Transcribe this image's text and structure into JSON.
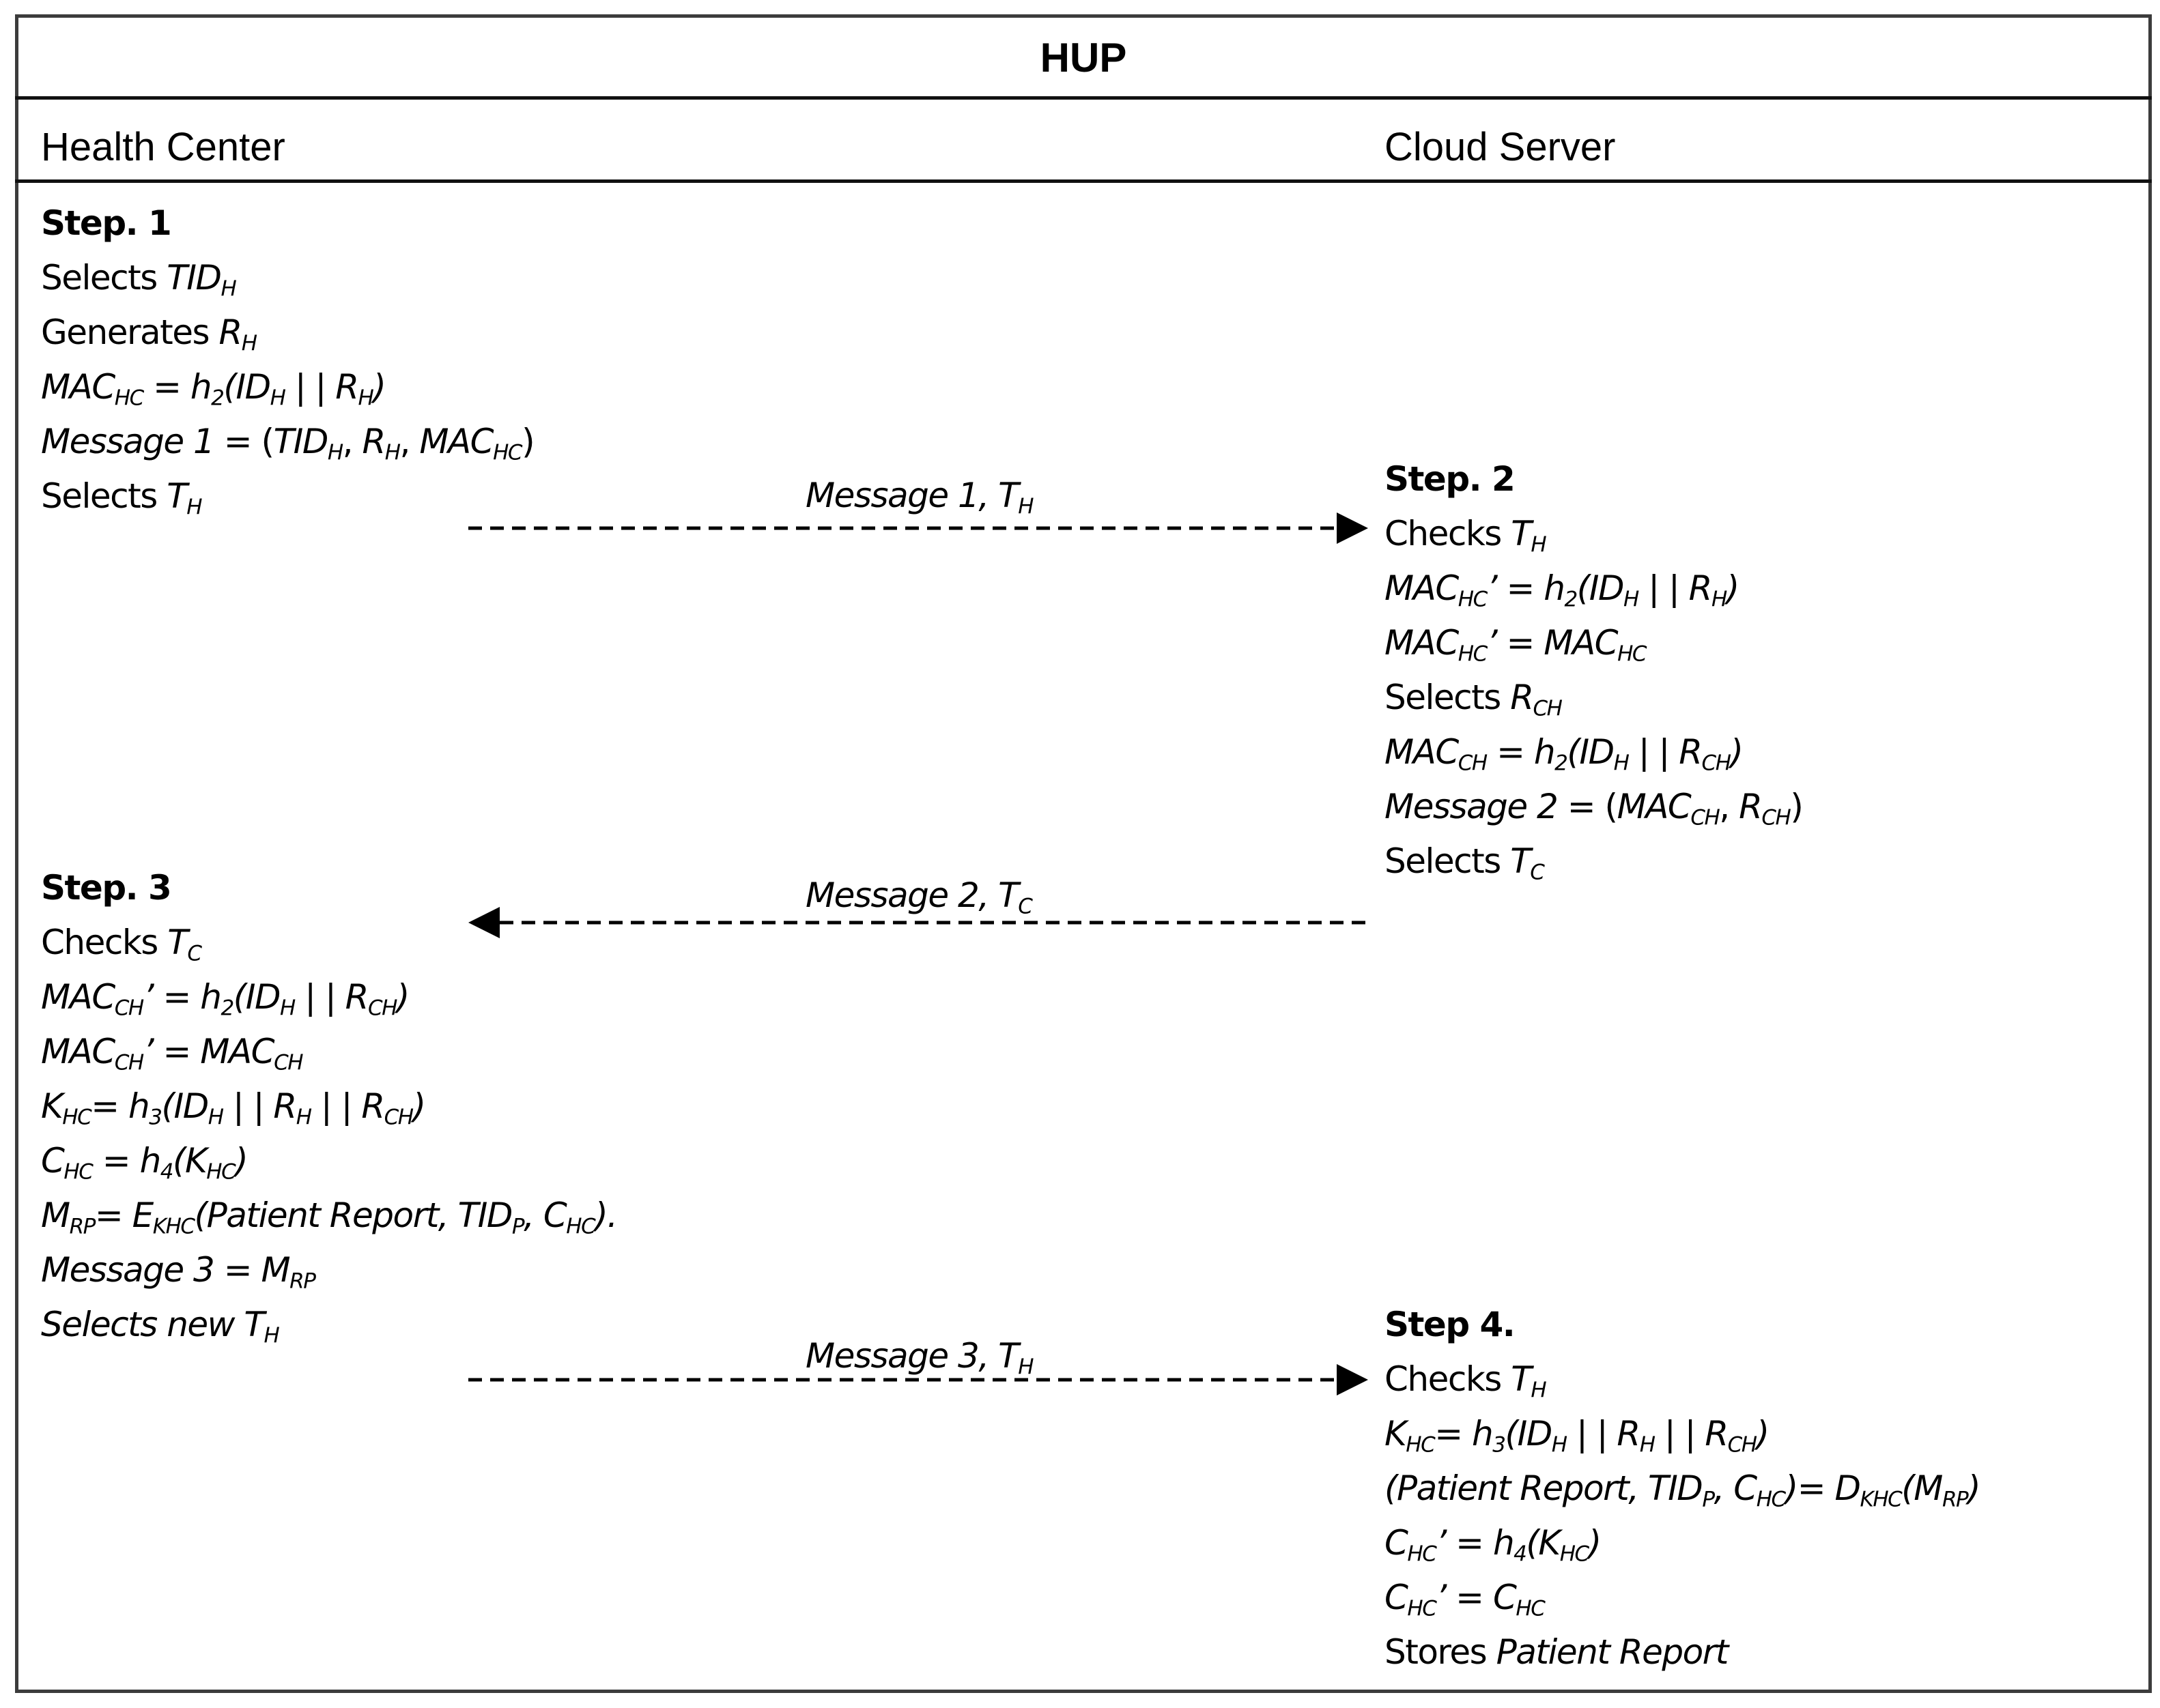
{
  "title": "HUP",
  "parties": {
    "left": "Health Center",
    "right": "Cloud Server"
  },
  "steps": {
    "step1": {
      "heading": "Step. 1",
      "lines": [
        [
          {
            "t": "Selects "
          },
          {
            "t": "TID",
            "i": true
          },
          {
            "t": "H",
            "sub": true,
            "i": true
          }
        ],
        [
          {
            "t": "Generates "
          },
          {
            "t": "R",
            "i": true
          },
          {
            "t": "H",
            "sub": true,
            "i": true
          }
        ],
        [
          {
            "t": "MAC",
            "i": true
          },
          {
            "t": "HC",
            "sub": true,
            "i": true
          },
          {
            "t": " = h",
            "i": true
          },
          {
            "t": "2",
            "sub": true,
            "i": true
          },
          {
            "t": "(ID",
            "i": true
          },
          {
            "t": "H",
            "sub": true,
            "i": true
          },
          {
            "t": " | | R",
            "i": true
          },
          {
            "t": "H",
            "sub": true,
            "i": true
          },
          {
            "t": ")",
            "i": true
          }
        ],
        [
          {
            "t": "Message 1",
            "i": true
          },
          {
            "t": " = ("
          },
          {
            "t": "TID",
            "i": true
          },
          {
            "t": "H",
            "sub": true,
            "i": true
          },
          {
            "t": ", "
          },
          {
            "t": "R",
            "i": true
          },
          {
            "t": "H",
            "sub": true,
            "i": true
          },
          {
            "t": ", "
          },
          {
            "t": "MAC",
            "i": true
          },
          {
            "t": "HC",
            "sub": true,
            "i": true
          },
          {
            "t": ")"
          }
        ],
        [
          {
            "t": "Selects "
          },
          {
            "t": "T",
            "i": true
          },
          {
            "t": "H",
            "sub": true,
            "i": true
          }
        ]
      ]
    },
    "step2": {
      "heading": "Step. 2",
      "lines": [
        [
          {
            "t": "Checks "
          },
          {
            "t": "T",
            "i": true
          },
          {
            "t": "H",
            "sub": true,
            "i": true
          }
        ],
        [
          {
            "t": "MAC",
            "i": true
          },
          {
            "t": "HC",
            "sub": true,
            "i": true
          },
          {
            "t": "’ = h",
            "i": true
          },
          {
            "t": "2",
            "sub": true,
            "i": true
          },
          {
            "t": "(ID",
            "i": true
          },
          {
            "t": "H",
            "sub": true,
            "i": true
          },
          {
            "t": " | | R",
            "i": true
          },
          {
            "t": "H",
            "sub": true,
            "i": true
          },
          {
            "t": ")",
            "i": true
          }
        ],
        [
          {
            "t": "MAC",
            "i": true
          },
          {
            "t": "HC",
            "sub": true,
            "i": true
          },
          {
            "t": "’ = MAC",
            "i": true
          },
          {
            "t": "HC",
            "sub": true,
            "i": true
          }
        ],
        [
          {
            "t": "Selects "
          },
          {
            "t": "R",
            "i": true
          },
          {
            "t": "CH",
            "sub": true,
            "i": true
          }
        ],
        [
          {
            "t": "MAC",
            "i": true
          },
          {
            "t": "CH",
            "sub": true,
            "i": true
          },
          {
            "t": " = h",
            "i": true
          },
          {
            "t": "2",
            "sub": true,
            "i": true
          },
          {
            "t": "(ID",
            "i": true
          },
          {
            "t": "H",
            "sub": true,
            "i": true
          },
          {
            "t": " | | R",
            "i": true
          },
          {
            "t": "CH",
            "sub": true,
            "i": true
          },
          {
            "t": ")",
            "i": true
          }
        ],
        [
          {
            "t": "Message 2",
            "i": true
          },
          {
            "t": " = ("
          },
          {
            "t": "MAC",
            "i": true
          },
          {
            "t": "CH",
            "sub": true,
            "i": true
          },
          {
            "t": ", "
          },
          {
            "t": "R",
            "i": true
          },
          {
            "t": "CH",
            "sub": true,
            "i": true
          },
          {
            "t": ")"
          }
        ],
        [
          {
            "t": "Selects "
          },
          {
            "t": "T",
            "i": true
          },
          {
            "t": "C",
            "sub": true,
            "i": true
          }
        ]
      ]
    },
    "step3": {
      "heading": "Step. 3",
      "lines": [
        [
          {
            "t": "Checks "
          },
          {
            "t": "T",
            "i": true
          },
          {
            "t": "C",
            "sub": true,
            "i": true
          }
        ],
        [
          {
            "t": "MAC",
            "i": true
          },
          {
            "t": "CH",
            "sub": true,
            "i": true
          },
          {
            "t": "’ = h",
            "i": true
          },
          {
            "t": "2",
            "sub": true,
            "i": true
          },
          {
            "t": "(ID",
            "i": true
          },
          {
            "t": "H",
            "sub": true,
            "i": true
          },
          {
            "t": " | | R",
            "i": true
          },
          {
            "t": "CH",
            "sub": true,
            "i": true
          },
          {
            "t": ")",
            "i": true
          }
        ],
        [
          {
            "t": "MAC",
            "i": true
          },
          {
            "t": "CH",
            "sub": true,
            "i": true
          },
          {
            "t": "’ = MAC",
            "i": true
          },
          {
            "t": "CH",
            "sub": true,
            "i": true
          }
        ],
        [
          {
            "t": "K",
            "i": true
          },
          {
            "t": "HC",
            "sub": true,
            "i": true
          },
          {
            "t": "= h",
            "i": true
          },
          {
            "t": "3",
            "sub": true,
            "i": true
          },
          {
            "t": "(ID",
            "i": true
          },
          {
            "t": "H",
            "sub": true,
            "i": true
          },
          {
            "t": " | | R",
            "i": true
          },
          {
            "t": "H",
            "sub": true,
            "i": true
          },
          {
            "t": " | | R",
            "i": true
          },
          {
            "t": "CH",
            "sub": true,
            "i": true
          },
          {
            "t": ")",
            "i": true
          }
        ],
        [
          {
            "t": "C",
            "i": true
          },
          {
            "t": "HC",
            "sub": true,
            "i": true
          },
          {
            "t": " = h",
            "i": true
          },
          {
            "t": "4",
            "sub": true,
            "i": true
          },
          {
            "t": "(K",
            "i": true
          },
          {
            "t": "HC",
            "sub": true,
            "i": true
          },
          {
            "t": ")",
            "i": true
          }
        ],
        [
          {
            "t": "M",
            "i": true
          },
          {
            "t": "RP",
            "sub": true,
            "i": true
          },
          {
            "t": "= E",
            "i": true
          },
          {
            "t": "KHC",
            "sub": true,
            "i": true
          },
          {
            "t": "(Patient Report, TID",
            "i": true
          },
          {
            "t": "P",
            "sub": true,
            "i": true
          },
          {
            "t": ", C",
            "i": true
          },
          {
            "t": "HC",
            "sub": true,
            "i": true
          },
          {
            "t": ").",
            "i": true
          }
        ],
        [
          {
            "t": "Message 3 = M",
            "i": true
          },
          {
            "t": "RP",
            "sub": true,
            "i": true
          }
        ],
        [
          {
            "t": "Selects new T",
            "i": true
          },
          {
            "t": "H",
            "sub": true,
            "i": true
          }
        ]
      ]
    },
    "step4": {
      "heading": "Step 4.",
      "lines": [
        [
          {
            "t": "Checks "
          },
          {
            "t": "T",
            "i": true
          },
          {
            "t": "H",
            "sub": true,
            "i": true
          }
        ],
        [
          {
            "t": "K",
            "i": true
          },
          {
            "t": "HC",
            "sub": true,
            "i": true
          },
          {
            "t": "= h",
            "i": true
          },
          {
            "t": "3",
            "sub": true,
            "i": true
          },
          {
            "t": "(ID",
            "i": true
          },
          {
            "t": "H",
            "sub": true,
            "i": true
          },
          {
            "t": " | | R",
            "i": true
          },
          {
            "t": "H",
            "sub": true,
            "i": true
          },
          {
            "t": " | | R",
            "i": true
          },
          {
            "t": "CH",
            "sub": true,
            "i": true
          },
          {
            "t": ")",
            "i": true
          }
        ],
        [
          {
            "t": "(Patient Report, TID",
            "i": true
          },
          {
            "t": "P",
            "sub": true,
            "i": true
          },
          {
            "t": ", C",
            "i": true
          },
          {
            "t": "HC",
            "sub": true,
            "i": true
          },
          {
            "t": ")= D",
            "i": true
          },
          {
            "t": "KHC",
            "sub": true,
            "i": true
          },
          {
            "t": "(M",
            "i": true
          },
          {
            "t": "RP",
            "sub": true,
            "i": true
          },
          {
            "t": ")",
            "i": true
          }
        ],
        [
          {
            "t": "C",
            "i": true
          },
          {
            "t": "HC",
            "sub": true,
            "i": true
          },
          {
            "t": "’ = h",
            "i": true
          },
          {
            "t": "4",
            "sub": true,
            "i": true
          },
          {
            "t": "(K",
            "i": true
          },
          {
            "t": "HC",
            "sub": true,
            "i": true
          },
          {
            "t": ")",
            "i": true
          }
        ],
        [
          {
            "t": "C",
            "i": true
          },
          {
            "t": "HC",
            "sub": true,
            "i": true
          },
          {
            "t": "’ = C",
            "i": true
          },
          {
            "t": "HC",
            "sub": true,
            "i": true
          }
        ],
        [
          {
            "t": "Stores "
          },
          {
            "t": "Patient Report",
            "i": true
          }
        ]
      ]
    }
  },
  "messages": [
    {
      "label": [
        {
          "t": "Message 1, T"
        },
        {
          "t": "H",
          "sub": true
        }
      ],
      "direction": "right"
    },
    {
      "label": [
        {
          "t": "Message 2, T"
        },
        {
          "t": "C",
          "sub": true
        }
      ],
      "direction": "left"
    },
    {
      "label": [
        {
          "t": "Message 3, T"
        },
        {
          "t": "H",
          "sub": true
        }
      ],
      "direction": "right"
    }
  ],
  "colors": {
    "border": "#3c3c3c",
    "divider": "#111111",
    "text": "#000000",
    "arrow": "#000000"
  }
}
